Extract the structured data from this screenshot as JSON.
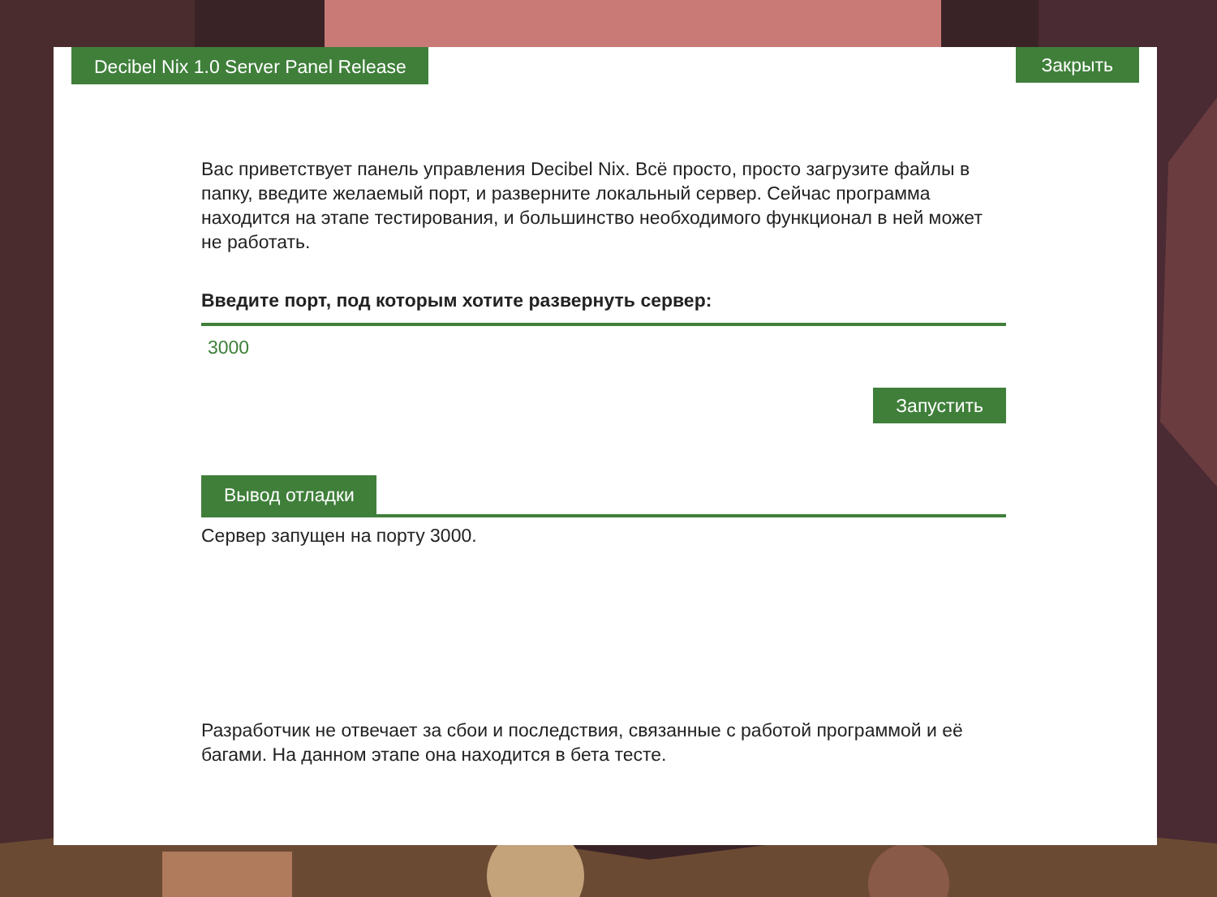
{
  "window": {
    "title": "Decibel Nix 1.0 Server Panel Release",
    "close_button": "Закрыть"
  },
  "intro": "Вас приветствует панель управления Decibel Nix. Всё просто, просто загрузите файлы в папку, введите желаемый порт, и разверните локальный сервер. Сейчас программа находится на этапе тестирования, и большинство необходимого функционал в ней может не работать.",
  "port": {
    "label": "Введите порт, под которым хотите развернуть сервер:",
    "value": "3000"
  },
  "start_button": "Запустить",
  "debug": {
    "title": "Вывод отладки",
    "output": "Сервер запущен на порту 3000."
  },
  "disclaimer": "Разработчик не отвечает за сбои и последствия, связанные с работой программой и её багами. На данном этапе она находится в бета тесте."
}
